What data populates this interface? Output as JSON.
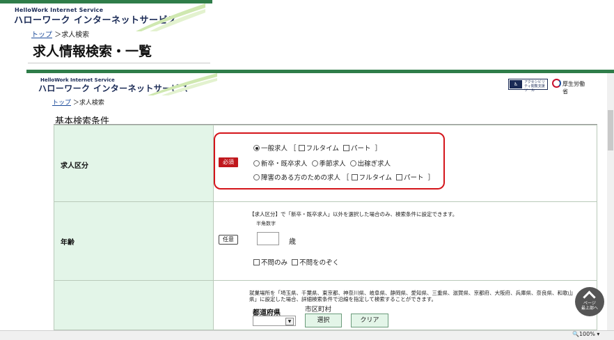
{
  "outer": {
    "logo_small": "HelloWork Internet Service",
    "logo_main": "ハローワーク インターネットサービス",
    "breadcrumb_link": "トップ",
    "breadcrumb_sep": "＞",
    "breadcrumb_current": "求人検索",
    "title": "求人情報検索・一覧"
  },
  "inner": {
    "logo_small": "HelloWork Internet Service",
    "logo_main": "ハローワーク インターネットサービス",
    "accessibility_badge": "アクセシビリティ閲覧支援ツール",
    "mhlw_label": "厚生労働省",
    "breadcrumb_link": "トップ",
    "breadcrumb_sep": "＞",
    "breadcrumb_current": "求人検索",
    "section_title": "基本検索条件"
  },
  "job_category": {
    "label": "求人区分",
    "badge": "必須",
    "row1": {
      "general": "一般求人",
      "bracket_open": "［",
      "fulltime": "フルタイム",
      "parttime": "パート",
      "bracket_close": "］"
    },
    "row2": {
      "new_grad": "新卒・既卒求人",
      "seasonal": "季節求人",
      "dekasegi": "出稼ぎ求人"
    },
    "row3": {
      "disability": "障害のある方のための求人",
      "bracket_open": "［",
      "fulltime": "フルタイム",
      "parttime": "パート",
      "bracket_close": "］"
    }
  },
  "age": {
    "label": "年齢",
    "badge": "任意",
    "note": "【求人区分】で「新卒・既卒求人」以外を選択した場合のみ、検索条件に設定できます。",
    "hint": "半角数字",
    "value": "",
    "unit": "歳",
    "only_unspecified": "不問のみ",
    "exclude_unspecified": "不問をのぞく"
  },
  "location": {
    "note": "就業場所を「埼玉県、千葉県、東京都、神奈川県、岐阜県、静岡県、愛知県、三重県、滋賀県、京都府、大阪府、兵庫県、奈良県、和歌山県」に設定した場合、詳細検索条件で沿線を指定して検索することができます。",
    "pref_label": "都道府県",
    "city_label": "市区町村",
    "pref_value": "",
    "select_button": "選択",
    "clear_button": "クリア"
  },
  "page_top": {
    "line1": "ページ",
    "line2": "最上部へ"
  },
  "zoom": "100%",
  "colors": {
    "accent_green": "#2f7d49",
    "required_red": "#c0171c",
    "highlight_red": "#d4141a",
    "label_bg": "#e3f5e8"
  }
}
